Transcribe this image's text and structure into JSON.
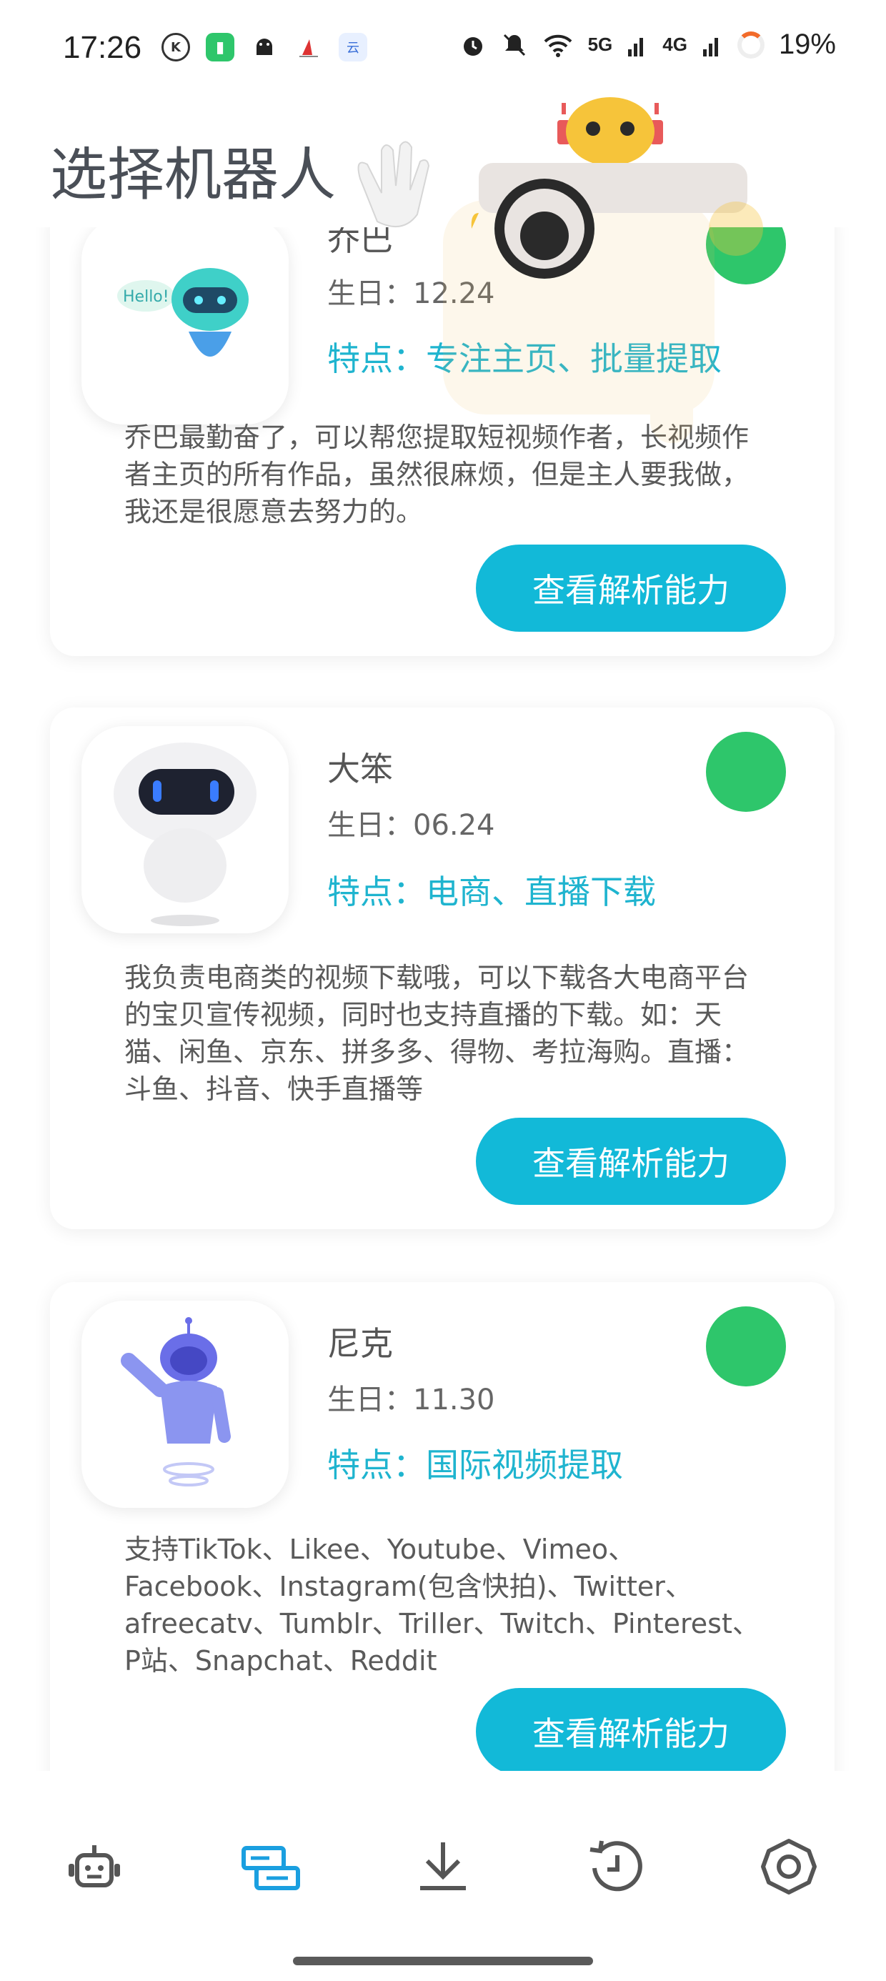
{
  "status_bar": {
    "time": "17:26",
    "network_5g": "5G",
    "network_4g": "4G",
    "battery": "19%",
    "icons_left": [
      "k-circle-icon",
      "battery-saver-icon",
      "android-icon",
      "app-icon",
      "cloud-app-icon"
    ],
    "icons_right": [
      "alarm-icon",
      "mute-icon",
      "wifi-icon",
      "signal-icon",
      "battery-ring-icon"
    ]
  },
  "header": {
    "title": "选择机器人"
  },
  "robots": [
    {
      "name": "乔巴",
      "birthday": "生日：12.24",
      "feature": "特点：专注主页、批量提取",
      "description": "乔巴最勤奋了，可以帮您提取短视频作者，长视频作者主页的所有作品，虽然很麻烦，但是主人要我做，我还是很愿意去努力的。",
      "button": "查看解析能力",
      "avatar_text": "Hello!",
      "status_color": "#2ec66b"
    },
    {
      "name": "大笨",
      "birthday": "生日：06.24",
      "feature": "特点：电商、直播下载",
      "description": "我负责电商类的视频下载哦，可以下载各大电商平台的宝贝宣传视频，同时也支持直播的下载。如：天猫、闲鱼、京东、拼多多、得物、考拉海购。直播：斗鱼、抖音、快手直播等",
      "button": "查看解析能力",
      "status_color": "#2ec66b"
    },
    {
      "name": "尼克",
      "birthday": "生日：11.30",
      "feature": "特点：国际视频提取",
      "description": "支持TikTok、Likee、Youtube、Vimeo、Facebook、Instagram(包含快拍)、Twitter、afreecatv、Tumblr、Triller、Twitch、Pinterest、P站、Snapchat、Reddit",
      "button": "查看解析能力",
      "status_color": "#2ec66b"
    }
  ],
  "bottom_nav": {
    "items": [
      "robot-icon",
      "parse-cards-icon",
      "download-icon",
      "history-icon",
      "settings-icon"
    ],
    "active_index": 1,
    "active_color": "#1a9fe0",
    "inactive_color": "#555555"
  },
  "colors": {
    "accent": "#12b9d8",
    "feature_text": "#1fb4cf",
    "status_online": "#2ec66b"
  }
}
